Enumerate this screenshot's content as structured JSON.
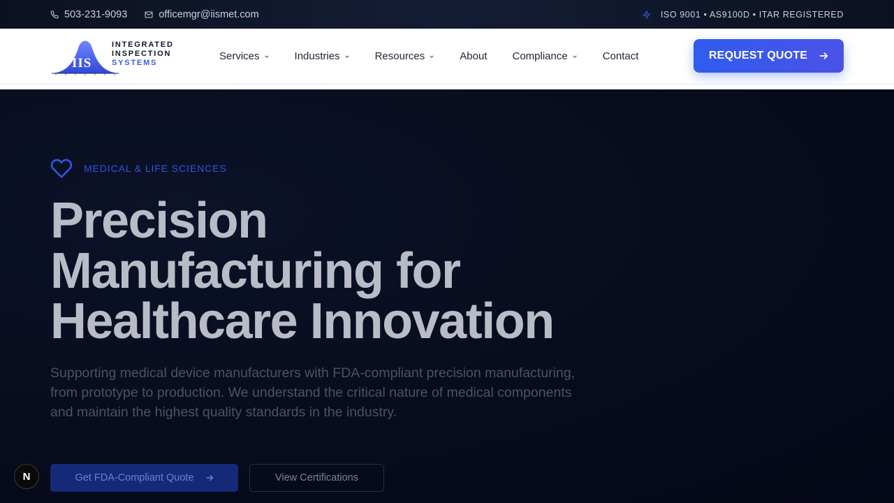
{
  "topbar": {
    "phone": "503-231-9093",
    "email": "officemgr@iismet.com",
    "certifications": "ISO 9001 • AS9100D • ITAR REGISTERED",
    "icons": [
      "phone-icon",
      "mail-icon",
      "bolt-icon"
    ]
  },
  "logo": {
    "mark": "IIS",
    "line1": "INTEGRATED",
    "line2": "INSPECTION",
    "line3": "SYSTEMS"
  },
  "nav": {
    "items": [
      {
        "label": "Services",
        "dropdown": true
      },
      {
        "label": "Industries",
        "dropdown": true
      },
      {
        "label": "Resources",
        "dropdown": true
      },
      {
        "label": "About",
        "dropdown": false
      },
      {
        "label": "Compliance",
        "dropdown": true
      },
      {
        "label": "Contact",
        "dropdown": false
      }
    ],
    "cta_label": "REQUEST QUOTE"
  },
  "hero": {
    "badge": "MEDICAL & LIFE SCIENCES",
    "headline_line1": "Precision",
    "headline_line2": "Manufacturing for",
    "headline_line3": "Healthcare Innovation",
    "description": "Supporting medical device manufacturers with FDA-compliant precision manufacturing, from prototype to production. We understand the critical nature of medical components and maintain the highest quality standards in the industry.",
    "primary_button": "Get FDA-Compliant Quote",
    "secondary_button": "View Certifications"
  },
  "floating_badge": "N",
  "colors": {
    "accent": "#2f5cf0",
    "hero_bg": "#060a1a",
    "topbar_bg": "#0b1120"
  }
}
